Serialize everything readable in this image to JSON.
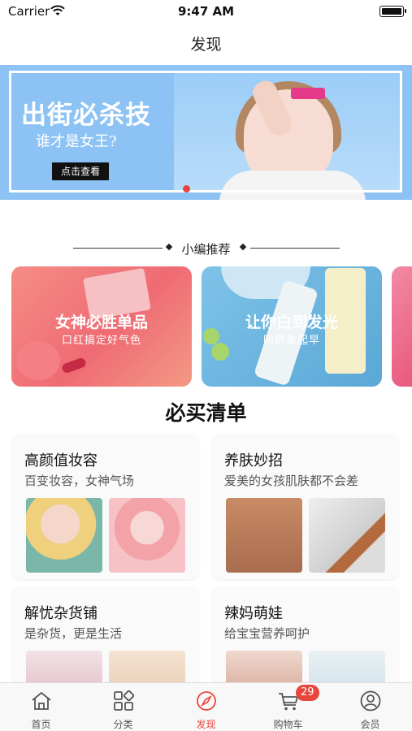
{
  "status_bar": {
    "carrier": "Carrier",
    "time": "9:47 AM"
  },
  "nav": {
    "title": "发现"
  },
  "banner": {
    "headline": "出街必杀技",
    "subtitle": "谁才是女王?",
    "cta": "点击查看"
  },
  "editor_section": {
    "label": "小编推荐",
    "cards": [
      {
        "title": "女神必胜单品",
        "subtitle": "口红搞定好气色"
      },
      {
        "title": "让你白到发光",
        "subtitle": "防晒美起早"
      }
    ]
  },
  "must_buy": {
    "title": "必买清单",
    "cards": [
      {
        "title": "高颜值妆容",
        "subtitle": "百变妆容，女神气场"
      },
      {
        "title": "养肤妙招",
        "subtitle": "爱美的女孩肌肤都不会差"
      },
      {
        "title": "解忧杂货铺",
        "subtitle": "是杂货，更是生活"
      },
      {
        "title": "辣妈萌娃",
        "subtitle": "给宝宝营养呵护"
      }
    ]
  },
  "tabbar": {
    "items": [
      {
        "label": "首页",
        "icon": "home-icon"
      },
      {
        "label": "分类",
        "icon": "grid-icon"
      },
      {
        "label": "发现",
        "icon": "compass-icon"
      },
      {
        "label": "购物车",
        "icon": "cart-icon"
      },
      {
        "label": "会员",
        "icon": "user-icon"
      }
    ],
    "active_index": 2,
    "cart_badge": "29",
    "accent_color": "#e8453c"
  }
}
